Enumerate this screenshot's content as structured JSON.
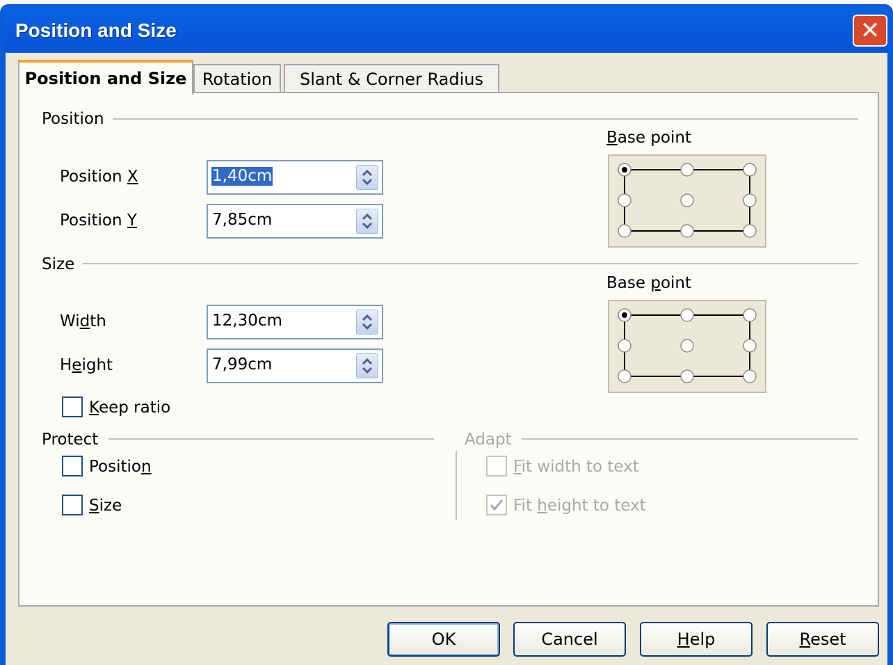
{
  "window": {
    "title": "Position and Size",
    "close_glyph": "✕"
  },
  "tabs": [
    {
      "label": "Position and Size",
      "active": true
    },
    {
      "label": "Rotation",
      "active": false
    },
    {
      "label": "Slant & Corner Radius",
      "active": false
    }
  ],
  "position": {
    "section_label": "Position",
    "x_label": "Position X",
    "x_value": "1,40cm",
    "y_label": "Position Y",
    "y_value": "7,85cm",
    "base_point_label": "Base point",
    "base_point_selected": "top-left"
  },
  "size": {
    "section_label": "Size",
    "width_label": "Width",
    "width_value": "12,30cm",
    "height_label": "Height",
    "height_value": "7,99cm",
    "keep_ratio_label": "Keep ratio",
    "keep_ratio_checked": false,
    "base_point_label": "Base point",
    "base_point_selected": "top-left"
  },
  "protect": {
    "section_label": "Protect",
    "position_label": "Position",
    "position_checked": false,
    "size_label": "Size",
    "size_checked": false
  },
  "adapt": {
    "section_label": "Adapt",
    "fit_width_label": "Fit width to text",
    "fit_width_checked": false,
    "fit_height_label": "Fit height to text",
    "fit_height_checked": true,
    "enabled": false
  },
  "buttons": {
    "ok": "OK",
    "cancel": "Cancel",
    "help": "Help",
    "reset": "Reset"
  },
  "colors": {
    "titlebar": "#0a5bd7",
    "dialog_bg": "#ece9d8",
    "selection": "#316ac5",
    "close_button": "#d94a2a"
  }
}
